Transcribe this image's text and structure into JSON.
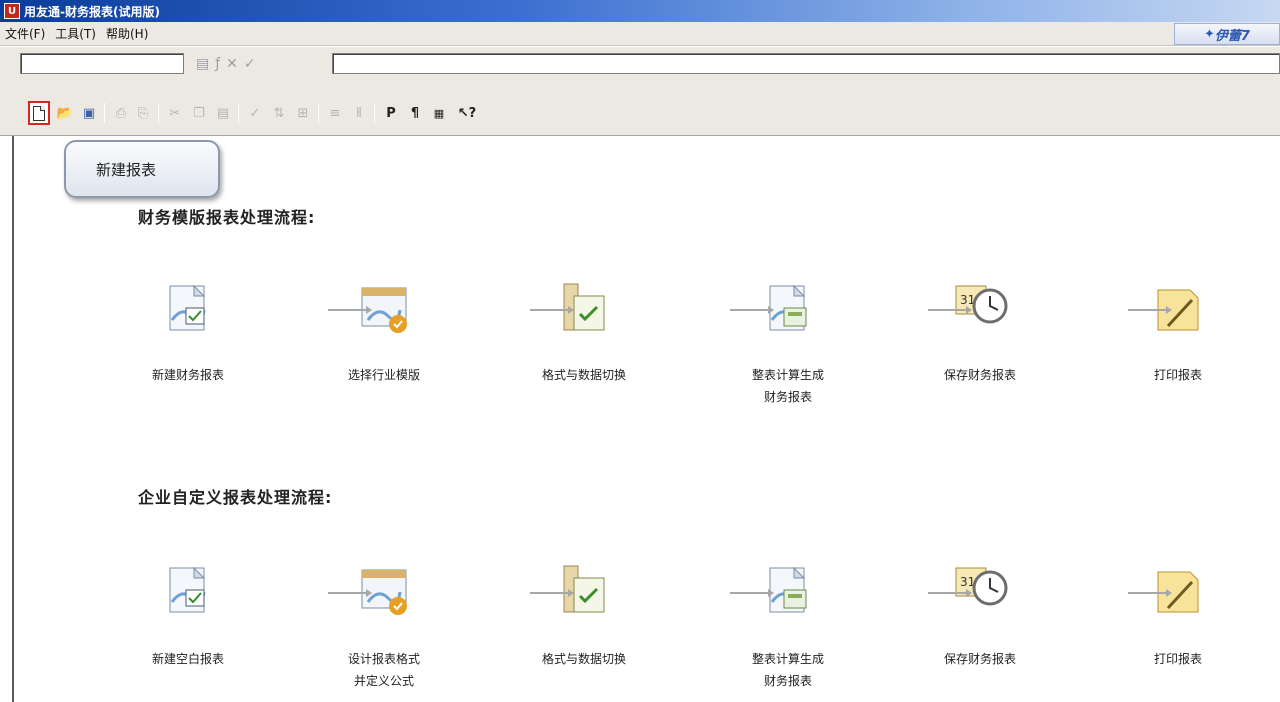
{
  "window": {
    "title": "用友通-财务报表(试用版)"
  },
  "menu": {
    "items": [
      "文件(F)",
      "工具(T)",
      "帮助(H)"
    ],
    "brand": "伊蕾7"
  },
  "editbar": {
    "cell_ref": "",
    "formula": "",
    "tools": [
      "▤",
      "ƒ",
      "✕",
      "✓"
    ]
  },
  "toolbar": {
    "buttons": [
      "new",
      "open",
      "save",
      "print-preview",
      "print",
      "cut",
      "copy",
      "paste",
      "format-painter",
      "sort",
      "filter",
      "insert-row",
      "insert-col",
      "p",
      "paragraph",
      "chart",
      "help"
    ]
  },
  "tooltip": {
    "text": "新建报表"
  },
  "flow1": {
    "title": "财务模版报表处理流程:",
    "steps": [
      {
        "label": "新建财务报表"
      },
      {
        "label": "选择行业模版"
      },
      {
        "label": "格式与数据切换"
      },
      {
        "label": "整表计算生成\n财务报表"
      },
      {
        "label": "保存财务报表"
      },
      {
        "label": "打印报表"
      }
    ]
  },
  "flow2": {
    "title": "企业自定义报表处理流程:",
    "steps": [
      {
        "label": "新建空白报表"
      },
      {
        "label": "设计报表格式\n并定义公式"
      },
      {
        "label": "格式与数据切换"
      },
      {
        "label": "整表计算生成\n财务报表"
      },
      {
        "label": "保存财务报表"
      },
      {
        "label": "打印报表"
      }
    ]
  }
}
